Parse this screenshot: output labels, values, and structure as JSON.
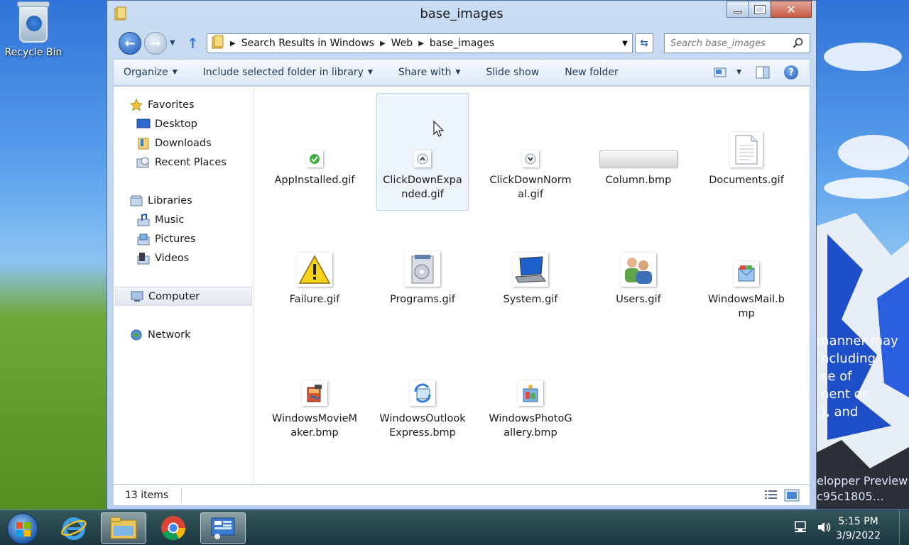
{
  "desktop": {
    "recycle_bin_label": "Recycle Bin",
    "background_text": [
      "manner may",
      "ncluding",
      "se of",
      "nent or",
      "), and"
    ],
    "background_text2": [
      "elopper Preview",
      "c95c1805…"
    ]
  },
  "window": {
    "title": "base_images",
    "breadcrumbs": [
      "Search Results in Windows",
      "Web",
      "base_images"
    ],
    "search_placeholder": "Search base_images",
    "toolbar": {
      "organize": "Organize",
      "include": "Include selected folder in library",
      "share": "Share with",
      "slideshow": "Slide show",
      "newfolder": "New folder"
    },
    "nav": {
      "favorites": "Favorites",
      "desktop": "Desktop",
      "downloads": "Downloads",
      "recent": "Recent Places",
      "libraries": "Libraries",
      "music": "Music",
      "pictures": "Pictures",
      "videos": "Videos",
      "computer": "Computer",
      "network": "Network"
    },
    "files": [
      {
        "name": "AppInstalled.gif",
        "icon": "check-icon"
      },
      {
        "name": "ClickDownExpanded.gif",
        "icon": "chevron-up-icon"
      },
      {
        "name": "ClickDownNormal.gif",
        "icon": "chevron-down-icon"
      },
      {
        "name": "Column.bmp",
        "icon": "column-bar-icon"
      },
      {
        "name": "Documents.gif",
        "icon": "document-icon"
      },
      {
        "name": "Failure.gif",
        "icon": "warning-icon"
      },
      {
        "name": "Programs.gif",
        "icon": "programs-icon"
      },
      {
        "name": "System.gif",
        "icon": "laptop-icon"
      },
      {
        "name": "Users.gif",
        "icon": "users-icon"
      },
      {
        "name": "WindowsMail.bmp",
        "icon": "mail-icon"
      },
      {
        "name": "WindowsMovieMaker.bmp",
        "icon": "movie-maker-icon"
      },
      {
        "name": "WindowsOutlookExpress.bmp",
        "icon": "outlook-express-icon"
      },
      {
        "name": "WindowsPhotoGallery.bmp",
        "icon": "photo-gallery-icon"
      }
    ],
    "status": "13 items"
  },
  "taskbar": {
    "time": "5:15 PM",
    "date": "3/9/2022"
  },
  "colors": {
    "selection_bg": "#edf4fc",
    "selection_border": "#bdd7f3",
    "accent": "#1f5bb8"
  }
}
